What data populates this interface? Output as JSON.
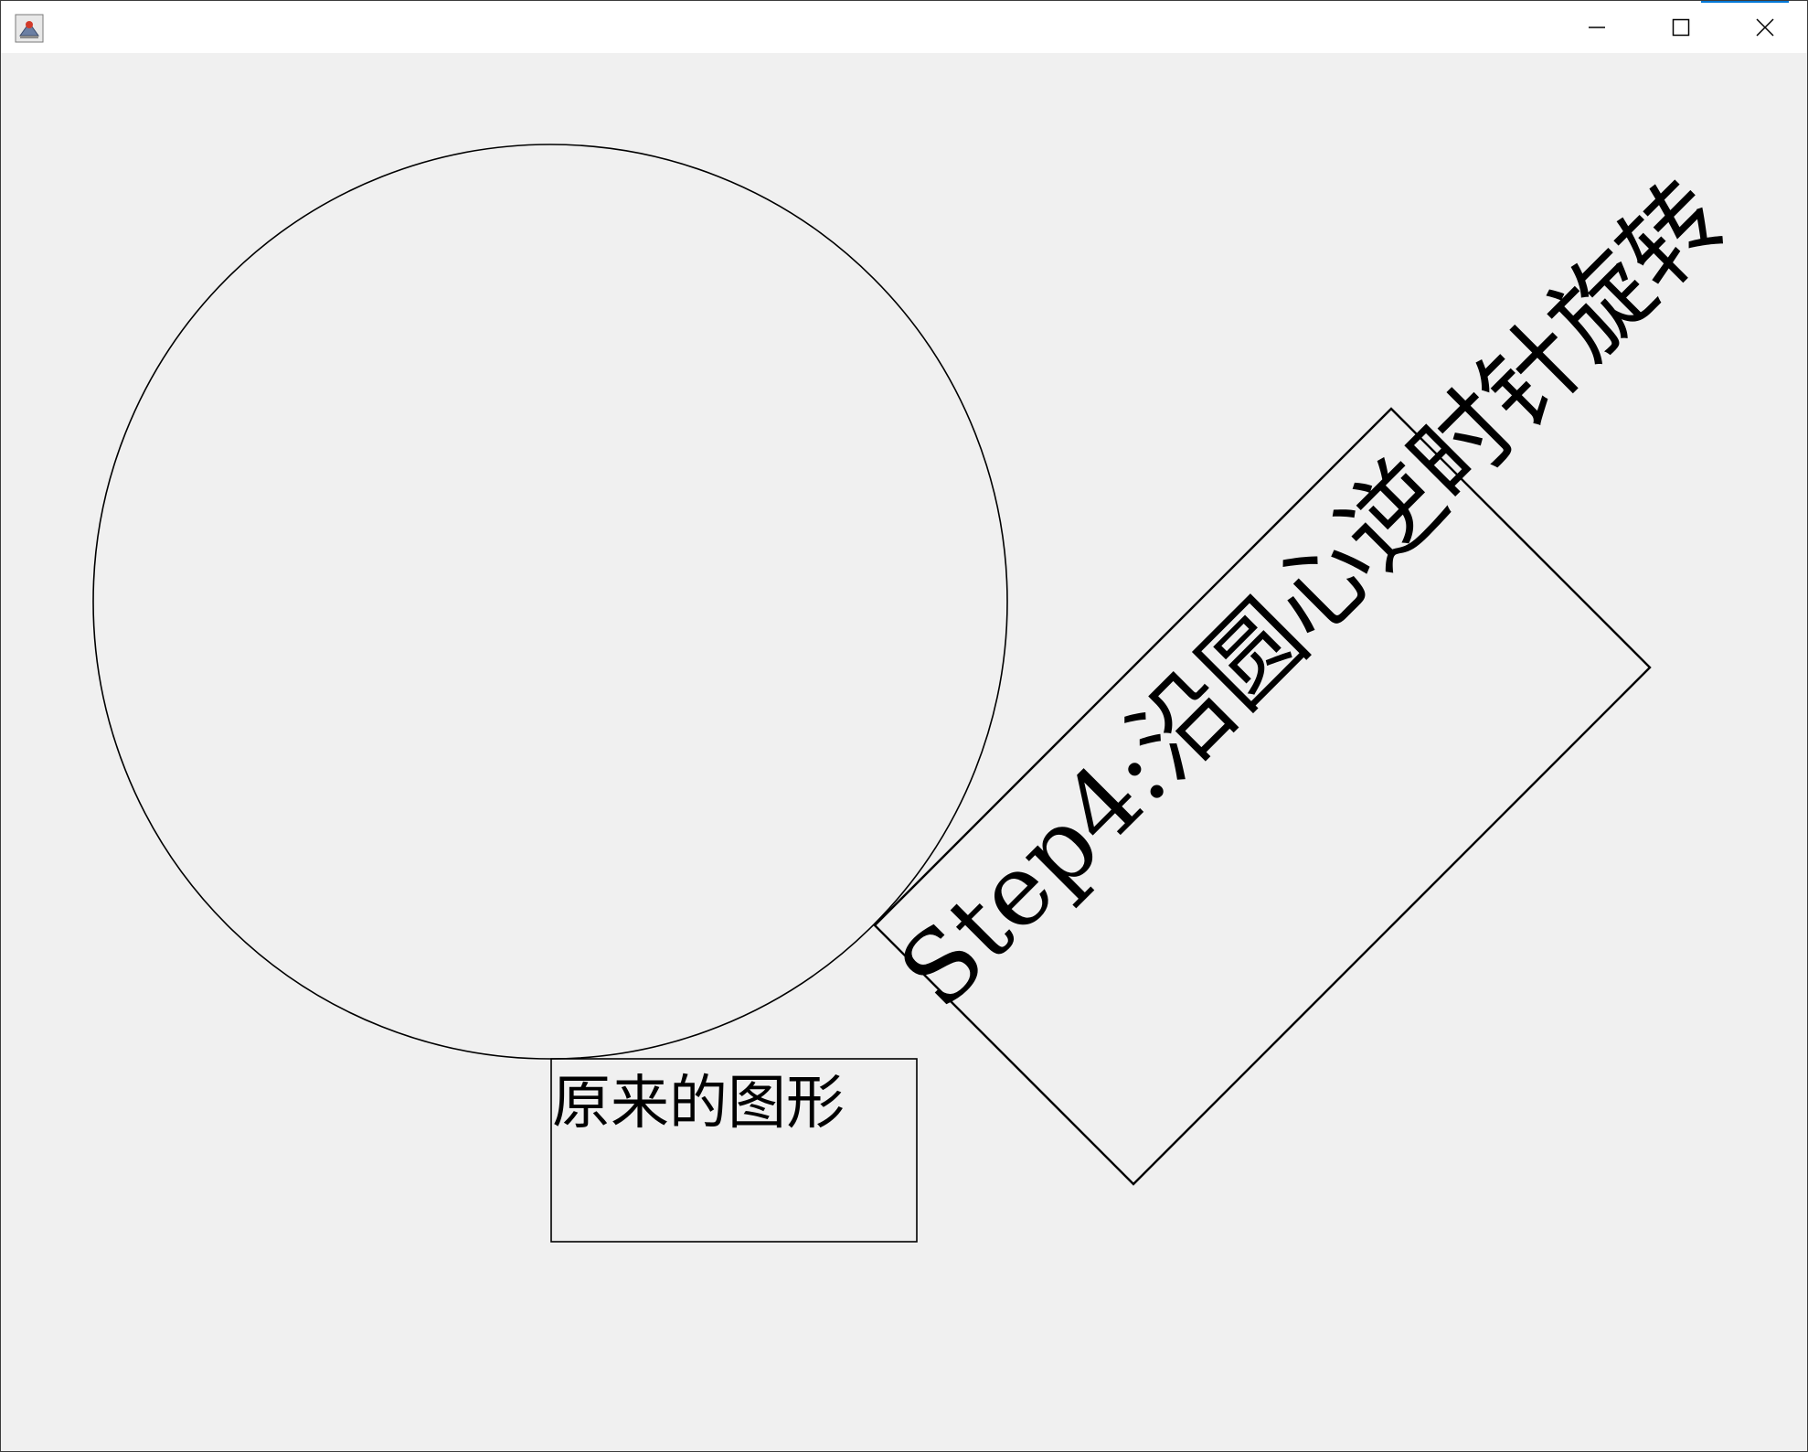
{
  "window": {
    "title": "",
    "controls": {
      "minimize": "minimize-icon",
      "maximize": "maximize-icon",
      "close": "close-icon"
    },
    "app_icon": "java-icon"
  },
  "canvas": {
    "original_label": "原来的图形",
    "rotated_label": "Step4:沿圆心逆时针旋转"
  },
  "colors": {
    "background": "#f0f0f0",
    "stroke": "#000000",
    "titlebar": "#ffffff"
  }
}
